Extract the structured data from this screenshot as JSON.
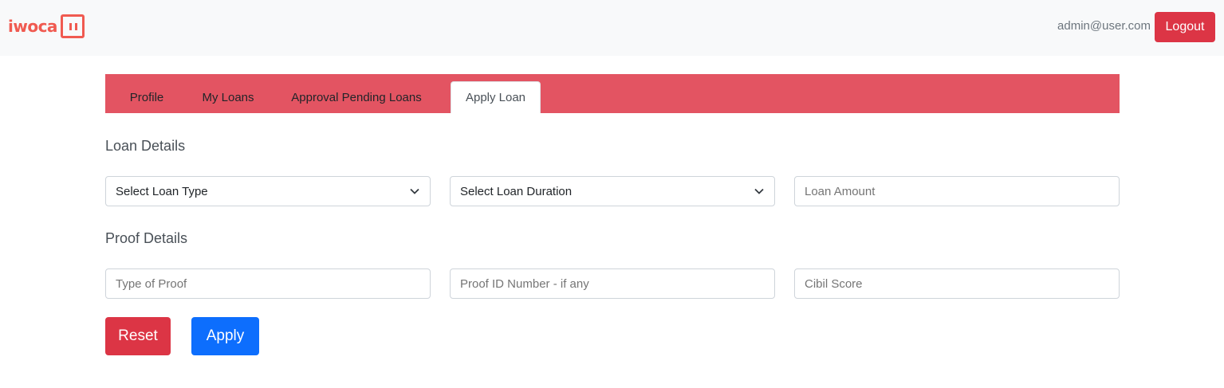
{
  "brand": {
    "name": "iwoca",
    "color": "#f05a50",
    "logo_icon": "iwoca-logo-mark"
  },
  "header": {
    "user_email": "admin@user.com",
    "logout_label": "Logout",
    "logout_color": "#dc3545"
  },
  "tabs": {
    "bar_color": "#e35462",
    "items": [
      {
        "label": "Profile",
        "active": false
      },
      {
        "label": "My Loans",
        "active": false
      },
      {
        "label": "Approval Pending Loans",
        "active": false
      },
      {
        "label": "Apply Loan",
        "active": true
      }
    ]
  },
  "form": {
    "loan_details": {
      "title": "Loan Details",
      "loan_type": {
        "selected": "Select Loan Type",
        "icon": "chevron-down-icon"
      },
      "loan_duration": {
        "selected": "Select Loan Duration",
        "icon": "chevron-down-icon"
      },
      "loan_amount": {
        "placeholder": "Loan Amount",
        "value": ""
      }
    },
    "proof_details": {
      "title": "Proof Details",
      "type_of_proof": {
        "placeholder": "Type of Proof",
        "value": ""
      },
      "proof_id": {
        "placeholder": "Proof ID Number - if any",
        "value": ""
      },
      "cibil_score": {
        "placeholder": "Cibil Score",
        "value": ""
      }
    },
    "reset_label": "Reset",
    "reset_color": "#dc3545",
    "apply_label": "Apply",
    "apply_color": "#0d6efd"
  }
}
